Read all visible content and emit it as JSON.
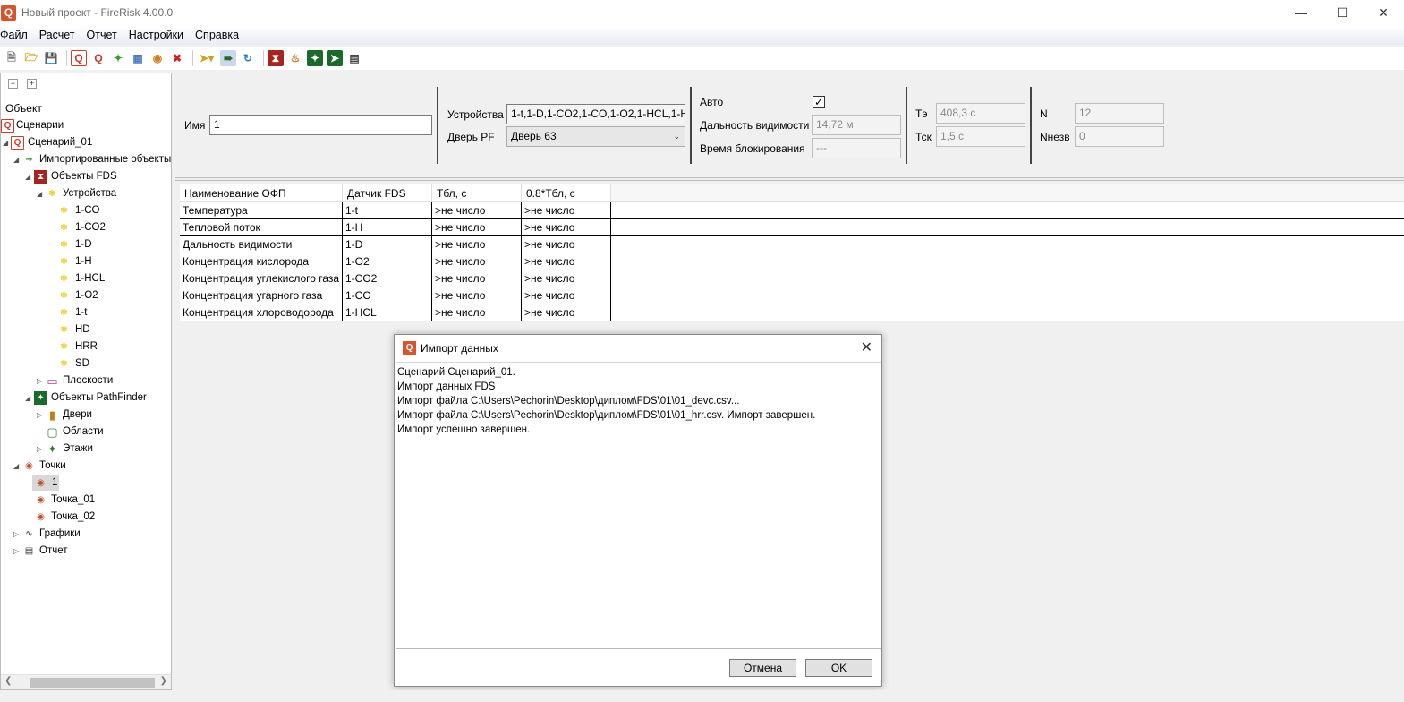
{
  "window": {
    "title": "Новый проект - FireRisk 4.00.0",
    "app_icon": "Q",
    "controls": [
      "minimize-icon",
      "maximize-icon",
      "close-icon"
    ]
  },
  "menu": [
    "Файл",
    "Расчет",
    "Отчет",
    "Настройки",
    "Справка"
  ],
  "tree": {
    "header": "Объект",
    "nodes": [
      {
        "label": "Сценарии",
        "icon": "scenario-q-icon"
      },
      {
        "label": "Сценарий_01",
        "icon": "scenario-q-icon"
      },
      {
        "label": "Импортированные объекты",
        "icon": "import-icon"
      },
      {
        "label": "Объекты FDS",
        "icon": "fds-icon"
      },
      {
        "label": "Устройства",
        "icon": "device-gear-icon"
      },
      {
        "label": "1-CO",
        "icon": "device-gear-icon"
      },
      {
        "label": "1-CO2",
        "icon": "device-gear-icon"
      },
      {
        "label": "1-D",
        "icon": "device-gear-icon"
      },
      {
        "label": "1-H",
        "icon": "device-gear-icon"
      },
      {
        "label": "1-HCL",
        "icon": "device-gear-icon"
      },
      {
        "label": "1-O2",
        "icon": "device-gear-icon"
      },
      {
        "label": "1-t",
        "icon": "device-gear-icon"
      },
      {
        "label": "HD",
        "icon": "device-gear-icon"
      },
      {
        "label": "HRR",
        "icon": "device-gear-icon"
      },
      {
        "label": "SD",
        "icon": "device-gear-icon"
      },
      {
        "label": "Плоскости",
        "icon": "plane-icon"
      },
      {
        "label": "Объекты PathFinder",
        "icon": "pathfinder-icon"
      },
      {
        "label": "Двери",
        "icon": "door-icon"
      },
      {
        "label": "Области",
        "icon": "area-icon"
      },
      {
        "label": "Этажи",
        "icon": "floor-icon"
      },
      {
        "label": "Точки",
        "icon": "point-icon"
      },
      {
        "label": "1",
        "icon": "point-icon"
      },
      {
        "label": "Точка_01",
        "icon": "point-icon"
      },
      {
        "label": "Точка_02",
        "icon": "point-icon"
      },
      {
        "label": "Графики",
        "icon": "chart-icon"
      },
      {
        "label": "Отчет",
        "icon": "report-icon"
      }
    ]
  },
  "props": {
    "name_label": "Имя",
    "name_value": "1",
    "devices_label": "Устройства",
    "devices_value": "1-t,1-D,1-CO2,1-CO,1-O2,1-HCL,1-H",
    "door_label": "Дверь PF",
    "door_value": "Дверь 63",
    "auto_label": "Авто",
    "auto_checked": true,
    "visibility_label": "Дальность видимости",
    "visibility_value": "14,72 м",
    "block_label": "Время блокирования",
    "block_value": "---",
    "te_label": "Тэ",
    "te_value": "408,3 с",
    "tsk_label": "Тск",
    "tsk_value": "1,5 с",
    "n_label": "N",
    "n_value": "12",
    "nevac_label": "Nнезв",
    "nevac_value": "0"
  },
  "grid": {
    "headers": [
      "Наименование ОФП",
      "Датчик FDS",
      "Тбл, с",
      "0.8*Тбл, с"
    ],
    "rows": [
      [
        "Температура",
        "1-t",
        ">не число",
        ">не число"
      ],
      [
        "Тепловой поток",
        "1-H",
        ">не число",
        ">не число"
      ],
      [
        "Дальность видимости",
        "1-D",
        ">не число",
        ">не число"
      ],
      [
        "Концентрация кислорода",
        "1-O2",
        ">не число",
        ">не число"
      ],
      [
        "Концентрация углекислого газа",
        "1-CO2",
        ">не число",
        ">не число"
      ],
      [
        "Концентрация угарного газа",
        "1-CO",
        ">не число",
        ">не число"
      ],
      [
        "Концентрация хлороводорода",
        "1-HCL",
        ">не число",
        ">не число"
      ]
    ]
  },
  "dialog": {
    "title": "Импорт данных",
    "log": [
      "Сценарий Сценарий_01.",
      "Импорт данных FDS",
      "Импорт файла C:\\Users\\Pechorin\\Desktop\\диплом\\FDS\\01\\01_devc.csv...",
      "Импорт файла C:\\Users\\Pechorin\\Desktop\\диплом\\FDS\\01\\01_hrr.csv. Импорт завершен.",
      "Импорт успешно завершен."
    ],
    "cancel": "Отмена",
    "ok": "OK"
  }
}
